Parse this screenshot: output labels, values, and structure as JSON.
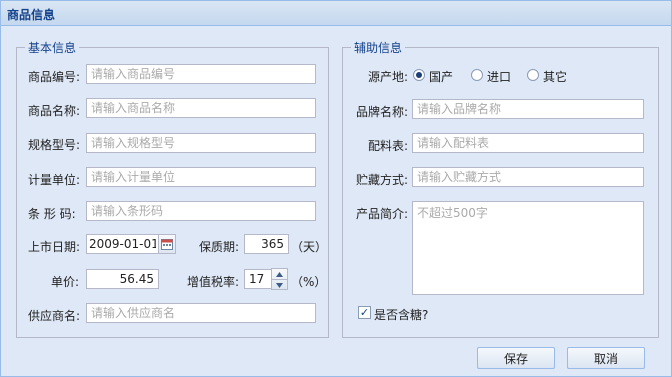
{
  "window": {
    "title": "商品信息"
  },
  "basic": {
    "legend": "基本信息",
    "code_label": "商品编号:",
    "code_placeholder": "请输入商品编号",
    "name_label": "商品名称:",
    "name_placeholder": "请输入商品名称",
    "spec_label": "规格型号:",
    "spec_placeholder": "请输入规格型号",
    "unit_label": "计量单位:",
    "unit_placeholder": "请输入计量单位",
    "barcode_label": "条 形 码:",
    "barcode_placeholder": "请输入条形码",
    "date_label": "上市日期:",
    "date_value": "2009-01-01",
    "shelf_label": "保质期:",
    "shelf_value": "365",
    "shelf_unit": "（天）",
    "price_label": "单价:",
    "price_value": "56.45",
    "tax_label": "增值税率:",
    "tax_value": "17",
    "tax_unit": "（%）",
    "supplier_label": "供应商名:",
    "supplier_placeholder": "请输入供应商名"
  },
  "aux": {
    "legend": "辅助信息",
    "origin_label": "源产地:",
    "origin_options": [
      "国产",
      "进口",
      "其它"
    ],
    "origin_selected": "国产",
    "brand_label": "品牌名称:",
    "brand_placeholder": "请输入品牌名称",
    "ingredients_label": "配料表:",
    "ingredients_placeholder": "请输入配料表",
    "storage_label": "贮藏方式:",
    "storage_placeholder": "请输入贮藏方式",
    "intro_label": "产品简介:",
    "intro_placeholder": "不超过500字",
    "sugar_label": "是否含糖?",
    "sugar_checked": true
  },
  "buttons": {
    "save": "保存",
    "cancel": "取消"
  }
}
